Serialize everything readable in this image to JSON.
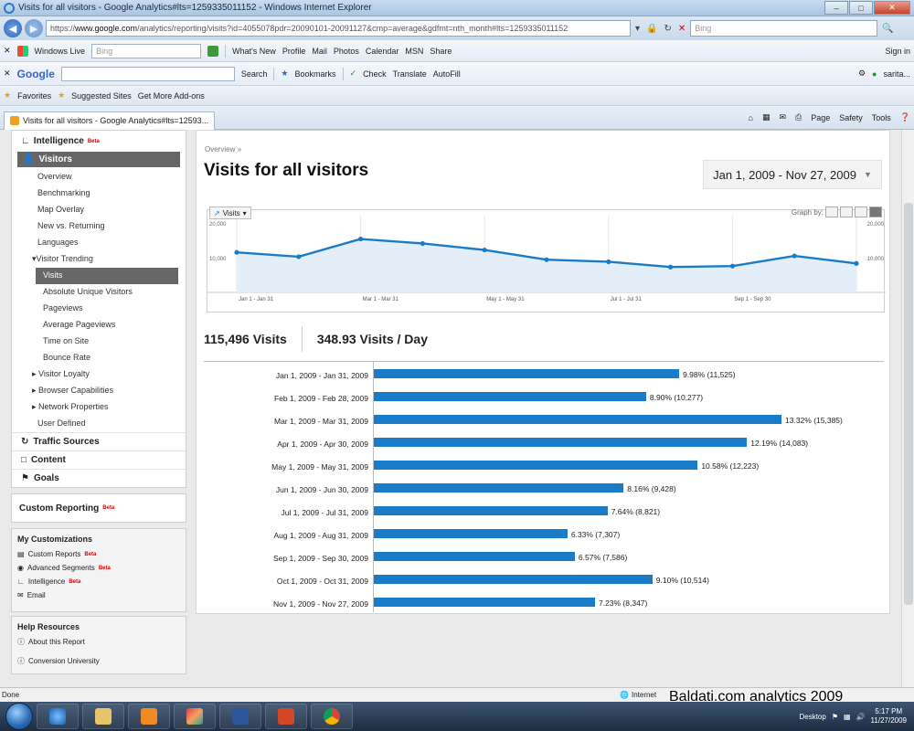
{
  "window": {
    "title": "Visits for all visitors - Google Analytics#lts=1259335011152 - Windows Internet Explorer",
    "url_prefix": "https://",
    "url_domain": "www.google.com",
    "url_rest": "/analytics/reporting/visits?id=4055078pdr=20090101-20091127&cmp=average&gdfmt=nth_month#lts=1259335011152",
    "search_placeholder": "Bing"
  },
  "toolbar1": {
    "windows_live": "Windows Live",
    "search_placeholder": "Bing",
    "links": [
      "What's New",
      "Profile",
      "Mail",
      "Photos",
      "Calendar",
      "MSN",
      "Share"
    ],
    "sign_in": "Sign in"
  },
  "toolbar2": {
    "google": "Google",
    "search": "Search",
    "bookmarks": "Bookmarks",
    "check": "Check",
    "translate": "Translate",
    "autofill": "AutoFill",
    "user": "sarita..."
  },
  "favorites_bar": {
    "favorites": "Favorites",
    "suggested": "Suggested Sites",
    "addons": "Get More Add-ons"
  },
  "tab": {
    "title": "Visits for all visitors - Google Analytics#lts=12593...",
    "page": "Page",
    "safety": "Safety",
    "tools": "Tools"
  },
  "sidebar": {
    "intelligence": "Intelligence",
    "beta": "Beta",
    "visitors": "Visitors",
    "items": [
      "Overview",
      "Benchmarking",
      "Map Overlay",
      "New vs. Returning",
      "Languages"
    ],
    "trending": "Visitor Trending",
    "trending_items": [
      "Visits",
      "Absolute Unique Visitors",
      "Pageviews",
      "Average Pageviews",
      "Time on Site",
      "Bounce Rate"
    ],
    "toggles": [
      "Visitor Loyalty",
      "Browser Capabilities",
      "Network Properties"
    ],
    "user_defined": "User Defined",
    "traffic_sources": "Traffic Sources",
    "content": "Content",
    "goals": "Goals",
    "custom_reporting": "Custom Reporting",
    "my_customizations": "My Customizations",
    "customizations": [
      "Custom Reports",
      "Advanced Segments",
      "Intelligence",
      "Email"
    ],
    "help_resources": "Help Resources",
    "help_items": [
      "About this Report",
      "Conversion University"
    ]
  },
  "main": {
    "breadcrumb": "Overview »",
    "title": "Visits for all visitors",
    "date_range": "Jan 1, 2009 - Nov 27, 2009",
    "metric_select": "Visits",
    "graph_by": "Graph by:",
    "total_visits": "115,496 Visits",
    "visits_per_day": "348.93 Visits / Day"
  },
  "chart_data": [
    {
      "type": "area",
      "series": [
        {
          "name": "Visits",
          "values": [
            11525,
            10277,
            15385,
            14083,
            12223,
            9428,
            8821,
            7307,
            7586,
            10514,
            8347
          ]
        }
      ],
      "x_labels": [
        "Jan 1 - Jan 31",
        "Mar 1 - Mar 31",
        "May 1 - May 31",
        "Jul 1 - Jul 31",
        "Sep 1 - Sep 30"
      ],
      "y_ticks": [
        "20,000",
        "10,000"
      ],
      "ylim": [
        0,
        20000
      ],
      "color": "#1a7cc9",
      "fill": "#e4eef9"
    },
    {
      "type": "bar",
      "categories": [
        "Jan 1, 2009 - Jan 31, 2009",
        "Feb 1, 2009 - Feb 28, 2009",
        "Mar 1, 2009 - Mar 31, 2009",
        "Apr 1, 2009 - Apr 30, 2009",
        "May 1, 2009 - May 31, 2009",
        "Jun 1, 2009 - Jun 30, 2009",
        "Jul 1, 2009 - Jul 31, 2009",
        "Aug 1, 2009 - Aug 31, 2009",
        "Sep 1, 2009 - Sep 30, 2009",
        "Oct 1, 2009 - Oct 31, 2009",
        "Nov 1, 2009 - Nov 27, 2009"
      ],
      "values": [
        11525,
        10277,
        15385,
        14083,
        12223,
        9428,
        8821,
        7307,
        7586,
        10514,
        8347
      ],
      "labels": [
        "9.98% (11,525)",
        "8.90% (10,277)",
        "13.32% (15,385)",
        "12.19% (14,083)",
        "10.58% (12,223)",
        "8.16% (9,428)",
        "7.64% (8,821)",
        "6.33% (7,307)",
        "6.57% (7,586)",
        "9.10% (10,514)",
        "7.23% (8,347)"
      ],
      "color": "#1a7cc9"
    }
  ],
  "statusbar": {
    "done": "Done",
    "zone": "Internet"
  },
  "watermark": "Baldati.com analytics 2009",
  "taskbar": {
    "desktop": "Desktop",
    "time": "5:17 PM",
    "date": "11/27/2009"
  }
}
